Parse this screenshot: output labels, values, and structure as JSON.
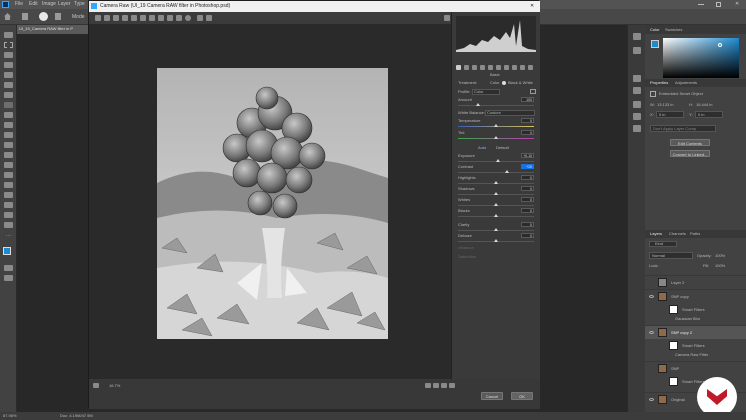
{
  "ps": {
    "menu": [
      "File",
      "Edit",
      "Image",
      "Layer",
      "Type"
    ],
    "options_mode_label": "Mode",
    "doc_tab": "UI_19_Camera RAW filter in P",
    "status_zoom": "87.98%",
    "status_doc": "Doc: 4.19M/47.9M"
  },
  "dialog": {
    "title": "Camera Raw (UI_19 Camera RAW filter in Photoshop.psd)",
    "basic_header": "Basic",
    "treatment_label": "Treatment:",
    "treatment_color": "Color",
    "treatment_bw": "Black & White",
    "profile_label": "Profile:",
    "profile_value": "Color",
    "amount_label": "Amount",
    "amount_value": "100",
    "white_balance_label": "White Balance:",
    "white_balance_value": "Custom",
    "temperature_label": "Temperature",
    "temperature_value": "0",
    "tint_label": "Tint",
    "tint_value": "0",
    "auto_label": "Auto",
    "default_label": "Default",
    "exposure_label": "Exposure",
    "exposure_value": "+0.10",
    "contrast_label": "Contrast",
    "contrast_value": "+26",
    "highlights_label": "Highlights",
    "highlights_value": "0",
    "shadows_label": "Shadows",
    "shadows_value": "0",
    "whites_label": "Whites",
    "whites_value": "0",
    "blacks_label": "Blacks",
    "blacks_value": "0",
    "clarity_label": "Clarity",
    "clarity_value": "0",
    "dehaze_label": "Dehaze",
    "dehaze_value": "0",
    "vibrance_label": "Vibrance",
    "saturation_label": "Saturation",
    "zoom_value": "16.7%",
    "cancel_label": "Cancel",
    "ok_label": "OK"
  },
  "panels": {
    "color_tab": "Color",
    "swatches_tab": "Swatches",
    "properties_tab": "Properties",
    "adjustments_tab": "Adjustments",
    "smart_object_label": "Embedded Smart Object",
    "w_label": "W:",
    "w_value": "13.133 in",
    "h_label": "H:",
    "h_value": "16.444 in",
    "x_label": "X:",
    "x_value": "0 in",
    "y_label": "Y:",
    "y_value": "0 in",
    "layer_comp_placeholder": "Don't Apply Layer Comp",
    "edit_contents_label": "Edit Contents",
    "convert_linked_label": "Convert to Linked...",
    "layers_tab": "Layers",
    "channels_tab": "Channels",
    "paths_tab": "Paths",
    "kind_label": "Kind",
    "blend_mode": "Normal",
    "opacity_label": "Opacity:",
    "opacity_value": "100%",
    "lock_label": "Lock:",
    "fill_label": "Fill:",
    "fill_value": "100%",
    "layers": [
      {
        "name": "Layer 2"
      },
      {
        "name": "SNP copy"
      },
      {
        "name": "Smart Filters"
      },
      {
        "name": "Gaussian Blur"
      },
      {
        "name": "SNP copy 2"
      },
      {
        "name": "Smart Filters"
      },
      {
        "name": "Camera Raw Filter"
      },
      {
        "name": "SNP"
      },
      {
        "name": "Smart Filters"
      },
      {
        "name": "Original"
      }
    ]
  },
  "colors": {
    "ps_accent": "#1473e6",
    "histogram_bg": "#2b2b2b",
    "brand_badge": "#c01a2a"
  }
}
